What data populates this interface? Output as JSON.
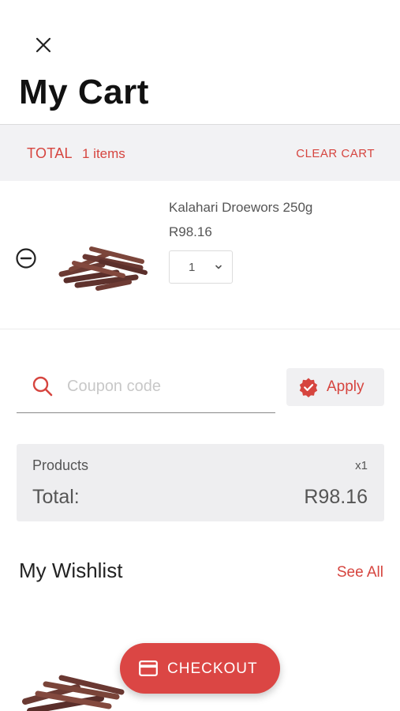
{
  "header": {
    "close_icon": "close-icon",
    "title": "My Cart"
  },
  "cart_summary_bar": {
    "total_label": "TOTAL",
    "items_count": "1 items",
    "clear_label": "CLEAR CART"
  },
  "cart_items": [
    {
      "name": "Kalahari Droewors 250g",
      "price": "R98.16",
      "quantity": "1",
      "remove_icon": "remove-circle-icon",
      "image": "droewors-product-image"
    }
  ],
  "coupon": {
    "placeholder": "Coupon code",
    "value": "",
    "apply_label": "Apply",
    "search_icon": "search-icon",
    "apply_icon": "verified-badge-icon"
  },
  "order_summary": {
    "products_label": "Products",
    "products_qty": "x1",
    "total_label": "Total:",
    "total_value": "R98.16"
  },
  "wishlist": {
    "title": "My Wishlist",
    "see_all_label": "See All"
  },
  "checkout": {
    "label": "CHECKOUT",
    "icon": "credit-card-icon"
  },
  "colors": {
    "accent": "#d6453f",
    "checkout_bg": "#db4644",
    "panel_bg": "#f2f2f4",
    "summary_bg": "#eeeef0"
  }
}
